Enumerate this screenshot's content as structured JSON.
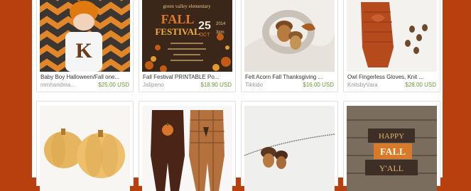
{
  "colors": {
    "background": "#b8400e",
    "panel": "#ffffff",
    "price": "#6b9b30",
    "shop": "#999999"
  },
  "listings_row1": [
    {
      "title": "Baby Boy Halloween/Fall one...",
      "shop": "mmhandma...",
      "price": "$25.00 USD",
      "image_text": "K"
    },
    {
      "title": "Fall Festival PRINTABLE Po...",
      "shop": "Jalipeno",
      "price": "$18.90 USD",
      "poster": {
        "line1": "green valley elementary",
        "line2": "FALL",
        "line3": "FESTIVAL",
        "date": "25",
        "month": "OCT",
        "year": "2014",
        "time": "3pm"
      }
    },
    {
      "title": "Felt Acorn Fall Thanksgiving ...",
      "shop": "Tikkido",
      "price": "$16.00 USD"
    },
    {
      "title": "Owl Fingerless Gloves, Knit ...",
      "shop": "KnitsbyVara",
      "price": "$28.00 USD"
    }
  ],
  "listings_row2": [
    {
      "image": "pumpkin-soaps"
    },
    {
      "image": "baby-overalls"
    },
    {
      "image": "acorn-necklace"
    },
    {
      "image": "fall-yall-blocks",
      "sign": {
        "top": "HAPPY",
        "mid": "FALL",
        "bottom": "Y'ALL"
      }
    }
  ]
}
